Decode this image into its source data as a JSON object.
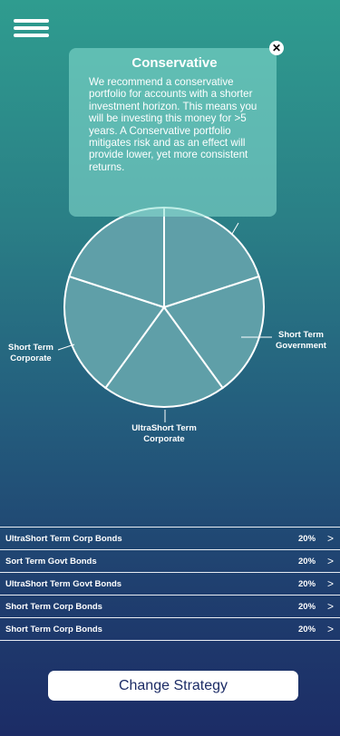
{
  "menu": {
    "icon": "hamburger-menu-icon"
  },
  "popup": {
    "title": "Conservative",
    "body": "We recommend a conservative portfolio for accounts with a shorter investment horizon.  This means you will be investing this money for >5 years.  A Conservative portfolio mitigates risk and as an effect will provide lower, yet more consistent returns.",
    "close_icon": "close-icon"
  },
  "chart_labels": {
    "short_term_government": [
      "Short Term",
      "Government"
    ],
    "ultrashort_term_corporate": [
      "UltraShort Term",
      "Corporate"
    ],
    "short_term_corporate": [
      "Short Term",
      "Corporate"
    ]
  },
  "chart_data": {
    "type": "pie",
    "slices": [
      {
        "label": "",
        "value": 20
      },
      {
        "label": "Short Term Government",
        "value": 20
      },
      {
        "label": "UltraShort Term Corporate",
        "value": 20
      },
      {
        "label": "Short Term Corporate",
        "value": 20
      },
      {
        "label": "",
        "value": 20
      }
    ],
    "colors": {
      "fill": "#5f9fa8",
      "stroke": "#ffffff"
    }
  },
  "holdings": [
    {
      "name": "UltraShort Term Corp Bonds",
      "pct": "20%",
      "arrow": ">"
    },
    {
      "name": "Sort Term Govt Bonds",
      "pct": "20%",
      "arrow": ">"
    },
    {
      "name": "UltraShort Term Govt Bonds",
      "pct": "20%",
      "arrow": ">"
    },
    {
      "name": "Short Term Corp Bonds",
      "pct": "20%",
      "arrow": ">"
    },
    {
      "name": "Short Term Corp Bonds",
      "pct": "20%",
      "arrow": ">"
    }
  ],
  "cta": {
    "label": "Change Strategy"
  }
}
